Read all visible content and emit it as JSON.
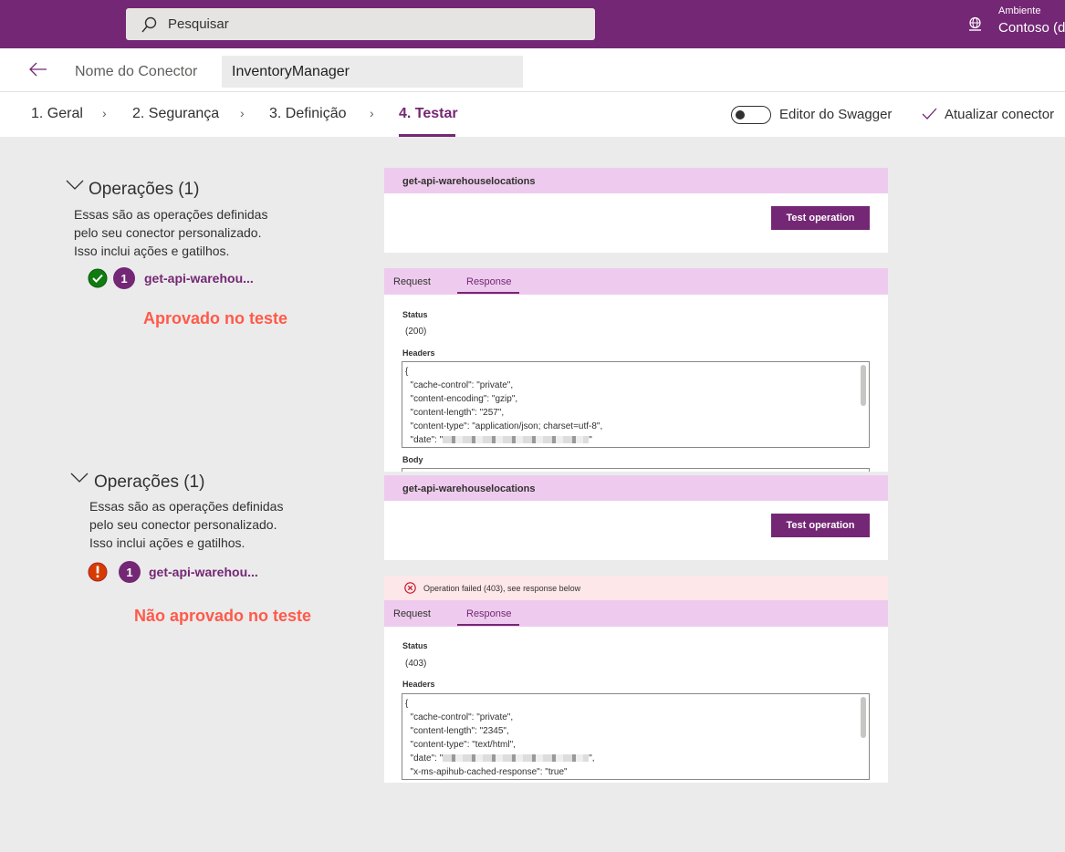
{
  "topbar": {
    "search_placeholder": "Pesquisar",
    "env_label": "Ambiente",
    "env_value": "Contoso (d"
  },
  "connector": {
    "name_label": "Nome do Conector",
    "name_value": "InventoryManager"
  },
  "steps": [
    "1. Geral",
    "2. Segurança",
    "3. Definição",
    "4. Testar"
  ],
  "active_step": "4. Testar",
  "toolbar": {
    "swagger_label": "Editor do Swagger",
    "swagger_on": false,
    "update_label": "Atualizar conector"
  },
  "colors": {
    "brand": "#742774",
    "success": "#107c10",
    "error": "#d83b01",
    "annotation": "#ff5a4a"
  },
  "sections": [
    {
      "ops_title": "Operações (1)",
      "desc": [
        "Essas são as operações definidas",
        "pelo seu conector personalizado.",
        "Isso inclui ações e gatilhos."
      ],
      "op_number": "1",
      "op_name": "get-api-warehou...",
      "status_icon": "check-circle-icon",
      "verdict": "Aprovado no teste",
      "card_title": "get-api-warehouselocations",
      "test_button": "Test operation",
      "tab_request": "Request",
      "tab_response": "Response",
      "status_label": "Status",
      "status_value": "(200)",
      "headers_label": "Headers",
      "body_label": "Body",
      "headers": [
        "{",
        "  \"cache-control\": \"private\",",
        "  \"content-encoding\": \"gzip\",",
        "  \"content-length\": \"257\",",
        "  \"content-type\": \"application/json; charset=utf-8\","
      ],
      "date_prefix": "  \"date\": \"",
      "date_suffix": "\""
    },
    {
      "ops_title": "Operações (1)",
      "desc": [
        "Essas são as operações definidas",
        "pelo seu conector personalizado.",
        "Isso inclui ações e gatilhos."
      ],
      "op_number": "1",
      "op_name": "get-api-warehou...",
      "status_icon": "error-circle-icon",
      "verdict": "Não aprovado no teste",
      "card_title": "get-api-warehouselocations",
      "test_button": "Test operation",
      "error_banner": "Operation failed (403), see response below",
      "tab_request": "Request",
      "tab_response": "Response",
      "status_label": "Status",
      "status_value": "(403)",
      "headers_label": "Headers",
      "headers": [
        "{",
        "  \"cache-control\": \"private\",",
        "  \"content-length\": \"2345\",",
        "  \"content-type\": \"text/html\","
      ],
      "date_prefix": "  \"date\": \"",
      "date_suffix": "\",",
      "headers_after": "  \"x-ms-apihub-cached-response\": \"true\""
    }
  ]
}
